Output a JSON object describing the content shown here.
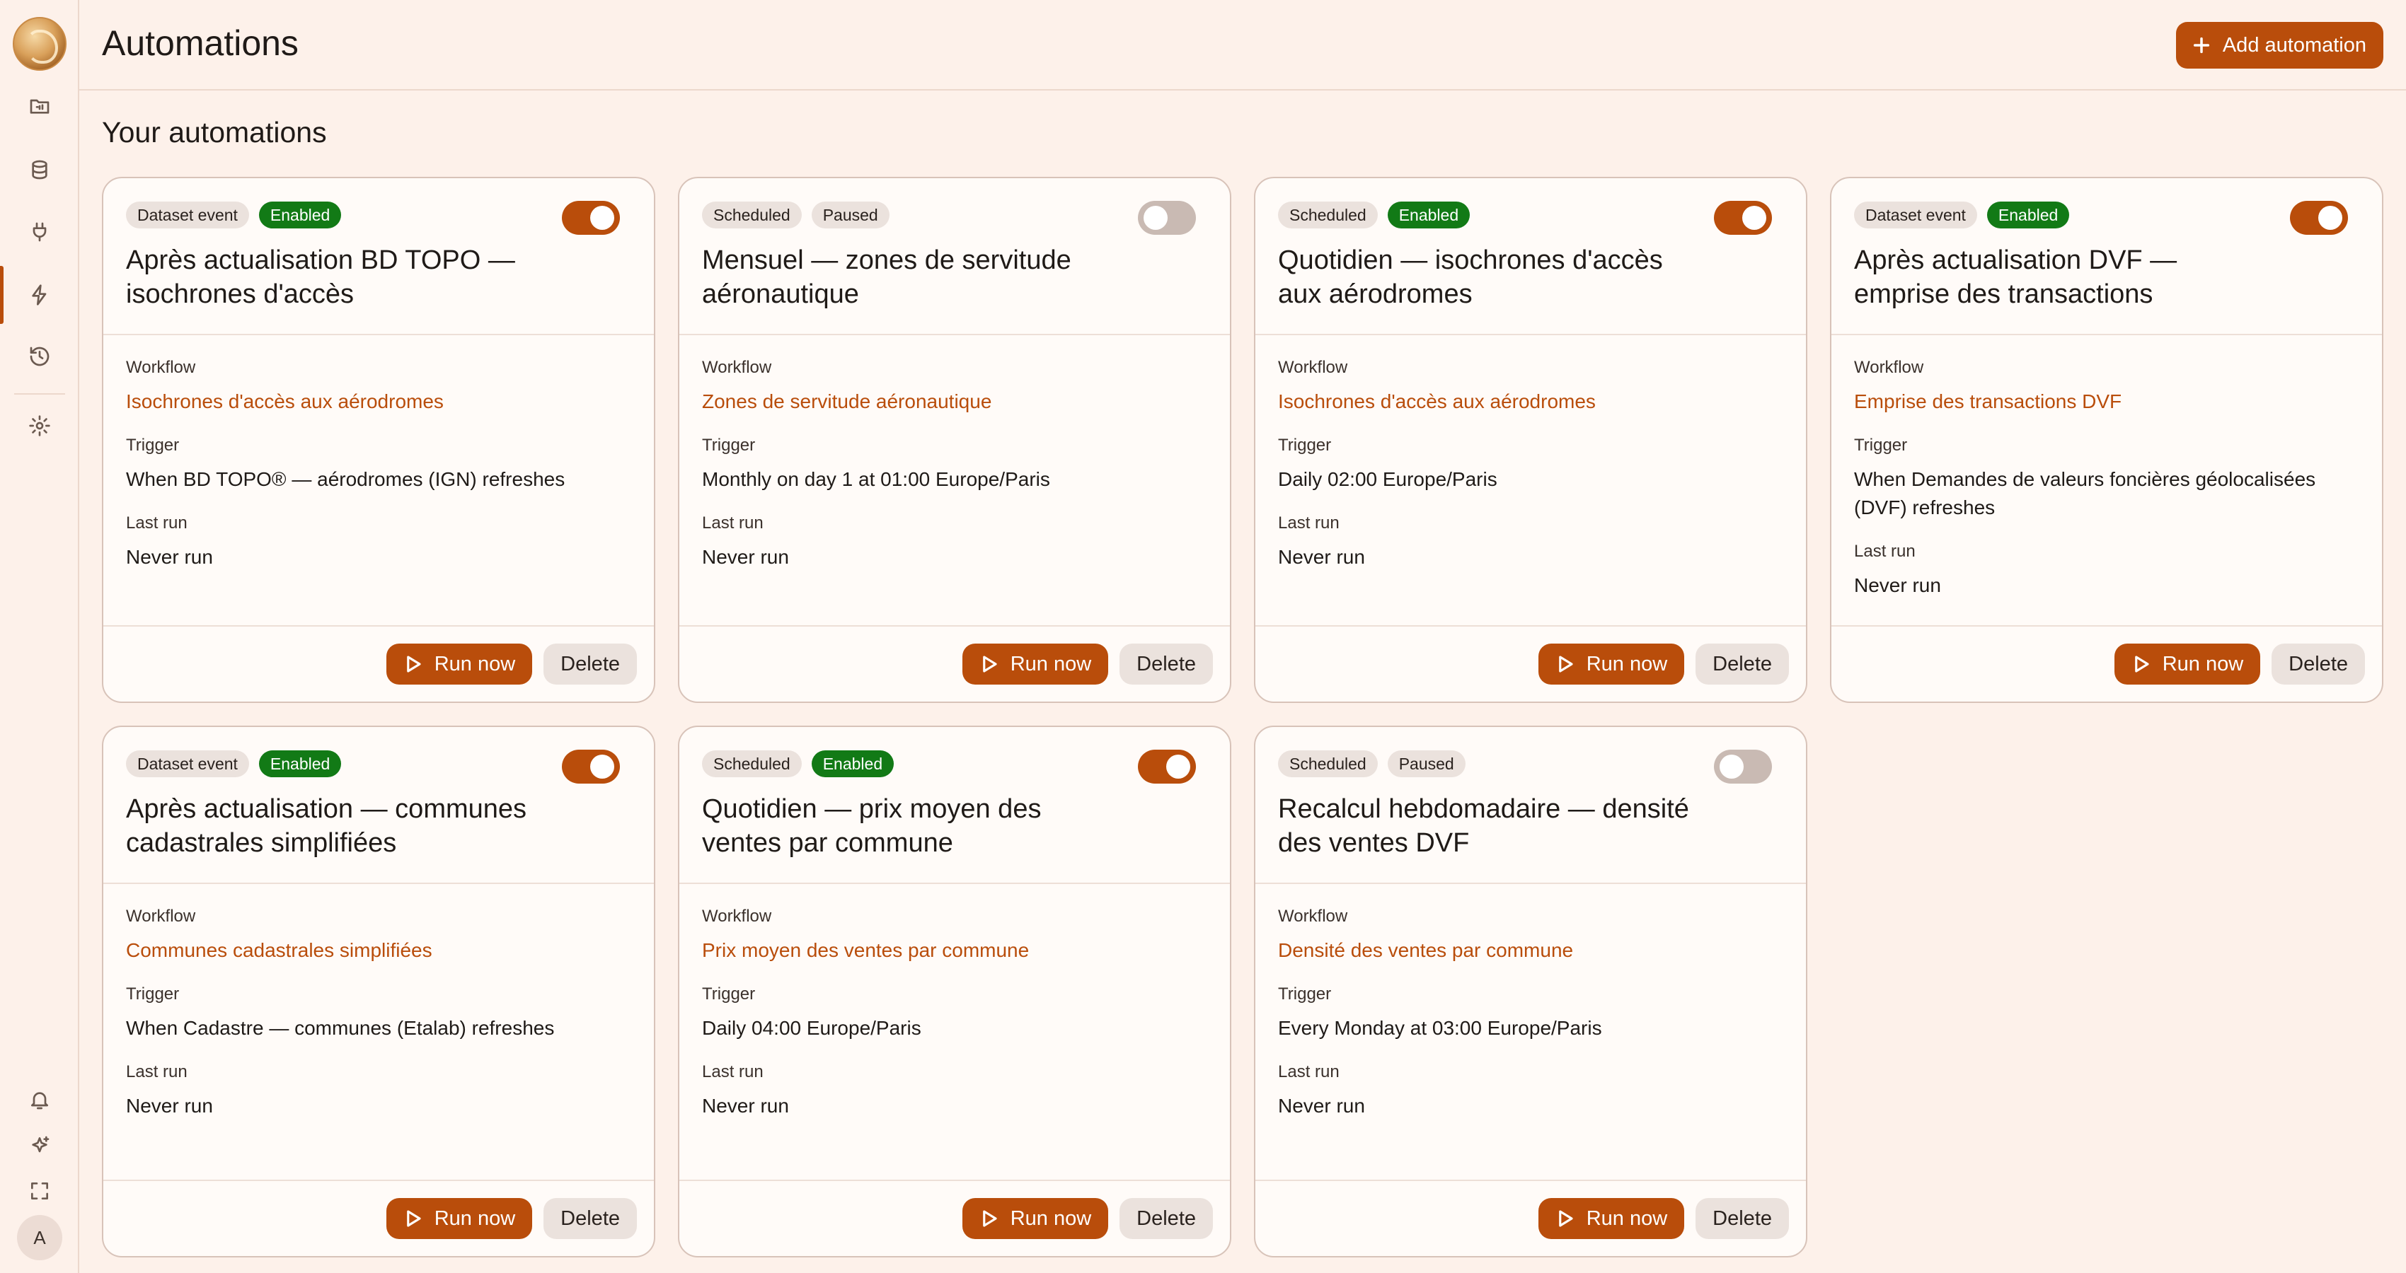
{
  "header": {
    "title": "Automations",
    "add_label": "Add automation"
  },
  "section_title": "Your automations",
  "sidebar": {
    "user_initial": "A",
    "items": [
      {
        "icon": "folder-icon",
        "active": false
      },
      {
        "icon": "database-icon",
        "active": false
      },
      {
        "icon": "plug-icon",
        "active": false
      },
      {
        "icon": "lightning-icon",
        "active": true
      },
      {
        "icon": "history-icon",
        "active": false
      },
      {
        "icon": "gear-icon",
        "active": false
      },
      {
        "icon": "bell-icon",
        "active": false
      },
      {
        "icon": "sparkles-icon",
        "active": false
      },
      {
        "icon": "fullscreen-icon",
        "active": false
      }
    ]
  },
  "labels": {
    "workflow": "Workflow",
    "trigger": "Trigger",
    "last_run": "Last run",
    "run_now": "Run now",
    "delete": "Delete"
  },
  "automations": [
    {
      "type": "Dataset event",
      "status": "Enabled",
      "enabled": true,
      "title": "Après actualisation BD TOPO — isochrones d'accès",
      "workflow": "Isochrones d'accès aux aérodromes",
      "trigger": "When BD TOPO® — aérodromes (IGN) refreshes",
      "last_run": "Never run"
    },
    {
      "type": "Scheduled",
      "status": "Paused",
      "enabled": false,
      "title": "Mensuel — zones de servitude aéronautique",
      "workflow": "Zones de servitude aéronautique",
      "trigger": "Monthly on day 1 at 01:00 Europe/Paris",
      "last_run": "Never run"
    },
    {
      "type": "Scheduled",
      "status": "Enabled",
      "enabled": true,
      "title": "Quotidien — isochrones d'accès aux aérodromes",
      "workflow": "Isochrones d'accès aux aérodromes",
      "trigger": "Daily 02:00 Europe/Paris",
      "last_run": "Never run"
    },
    {
      "type": "Dataset event",
      "status": "Enabled",
      "enabled": true,
      "title": "Après actualisation DVF — emprise des transactions",
      "workflow": "Emprise des transactions DVF",
      "trigger": "When Demandes de valeurs foncières géolocalisées (DVF) refreshes",
      "last_run": "Never run"
    },
    {
      "type": "Dataset event",
      "status": "Enabled",
      "enabled": true,
      "title": "Après actualisation — communes cadastrales simplifiées",
      "workflow": "Communes cadastrales simplifiées",
      "trigger": "When Cadastre — communes (Etalab) refreshes",
      "last_run": "Never run"
    },
    {
      "type": "Scheduled",
      "status": "Enabled",
      "enabled": true,
      "title": "Quotidien — prix moyen des ventes par commune",
      "workflow": "Prix moyen des ventes par commune",
      "trigger": "Daily 04:00 Europe/Paris",
      "last_run": "Never run"
    },
    {
      "type": "Scheduled",
      "status": "Paused",
      "enabled": false,
      "title": "Recalcul hebdomadaire — densité des ventes DVF",
      "workflow": "Densité des ventes par commune",
      "trigger": "Every Monday at 03:00 Europe/Paris",
      "last_run": "Never run"
    }
  ]
}
